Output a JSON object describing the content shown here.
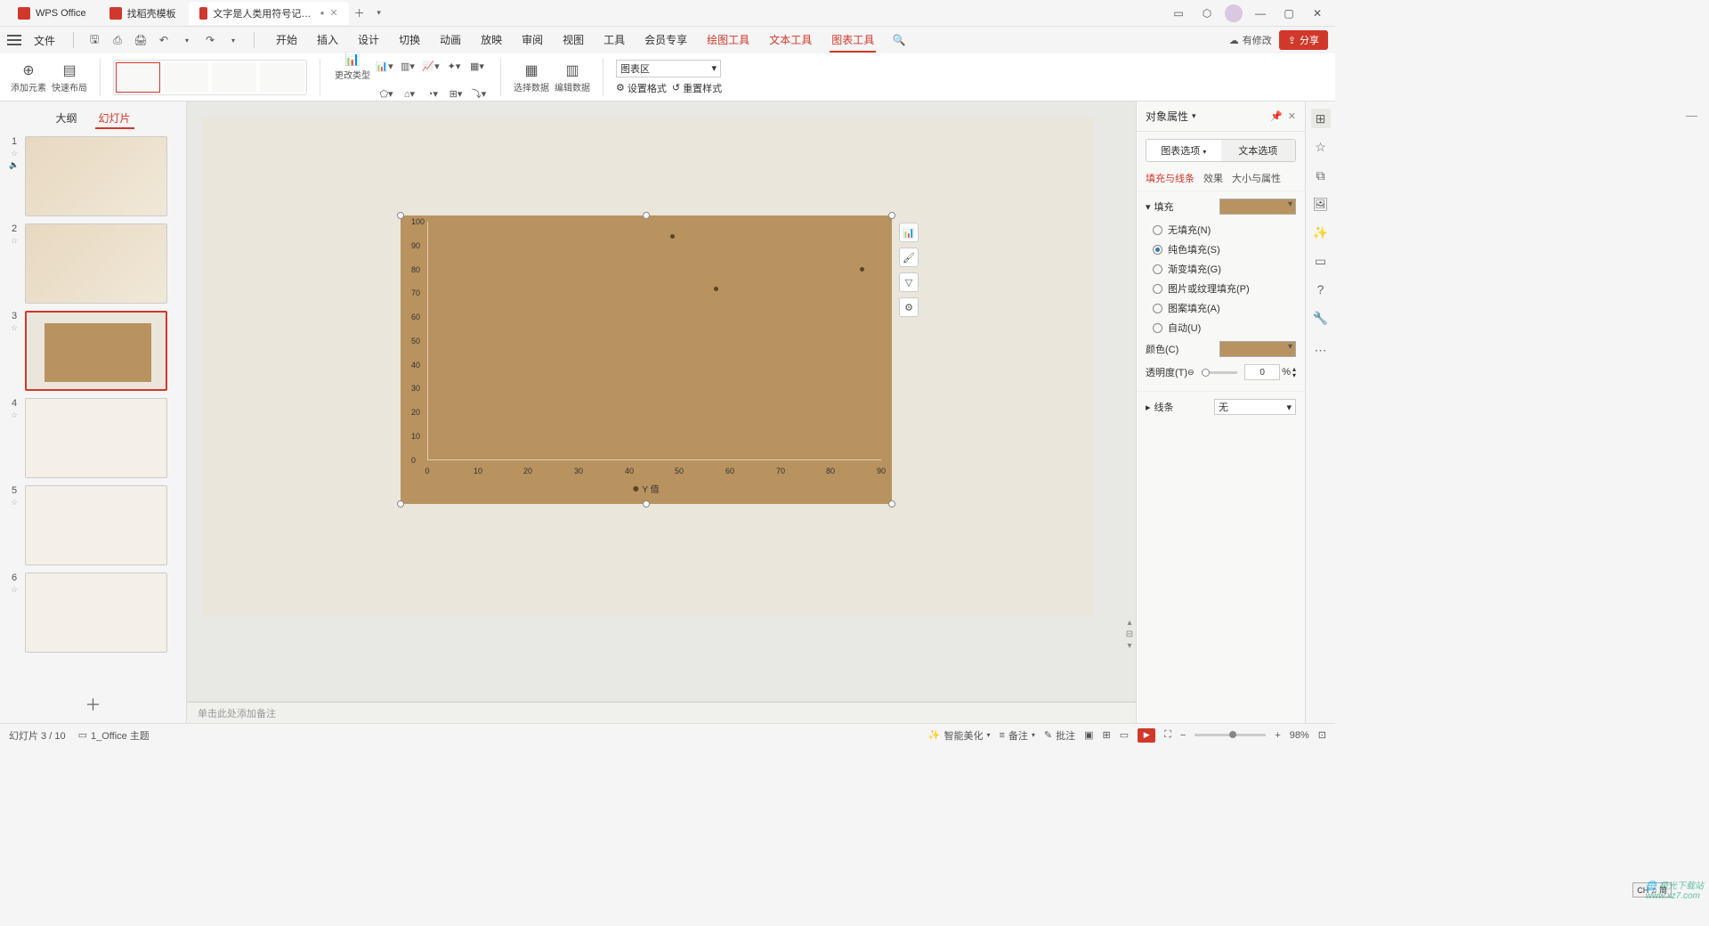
{
  "titlebar": {
    "tabs": [
      {
        "icon": "wps",
        "label": "WPS Office"
      },
      {
        "icon": "tpl",
        "label": "找稻壳模板"
      },
      {
        "icon": "ppt",
        "label": "文字是人类用符号记录表达信息以"
      }
    ],
    "modified_dot": "●"
  },
  "menubar": {
    "file": "文件",
    "ribbon_tabs": [
      "开始",
      "插入",
      "设计",
      "切换",
      "动画",
      "放映",
      "审阅",
      "视图",
      "工具",
      "会员专享",
      "绘图工具",
      "文本工具",
      "图表工具"
    ],
    "cloud_status": "有修改",
    "share": "分享"
  },
  "ribbon": {
    "add_element": "添加元素",
    "quick_layout": "快速布局",
    "change_type": "更改类型",
    "select_data": "选择数据",
    "edit_data": "编辑数据",
    "chart_area_label": "图表区",
    "set_format": "设置格式",
    "reset_style": "重置样式"
  },
  "slide_nav": {
    "tabs": {
      "outline": "大纲",
      "slides": "幻灯片"
    },
    "add": "＋"
  },
  "chart_data": {
    "type": "scatter",
    "selection": "图表区",
    "x_range": [
      0,
      90
    ],
    "y_range": [
      0,
      100
    ],
    "x_ticks": [
      0,
      10,
      20,
      30,
      40,
      50,
      60,
      70,
      80,
      90
    ],
    "y_ticks": [
      0,
      10,
      20,
      30,
      40,
      50,
      60,
      70,
      80,
      90,
      100
    ],
    "series": [
      {
        "name": "Y 值",
        "points": [
          [
            48.5,
            94
          ],
          [
            57,
            72
          ],
          [
            86,
            80
          ]
        ]
      }
    ],
    "background_color": "#b8935f"
  },
  "notes_placeholder": "单击此处添加备注",
  "props": {
    "title": "对象属性",
    "subtabs": {
      "chart_options": "图表选项",
      "text_options": "文本选项"
    },
    "tabs2": {
      "fill_line": "填充与线条",
      "effect": "效果",
      "size_props": "大小与属性"
    },
    "fill_section": "填充",
    "fills": {
      "none": "无填充(N)",
      "solid": "纯色填充(S)",
      "gradient": "渐变填充(G)",
      "picture": "图片或纹理填充(P)",
      "pattern": "图案填充(A)",
      "auto": "自动(U)"
    },
    "color_label": "颜色(C)",
    "opacity_label": "透明度(T)",
    "opacity_value": "0",
    "opacity_unit": "%",
    "line_section": "线条",
    "line_value": "无",
    "fill_color": "#b8935f"
  },
  "statusbar": {
    "slide_pos": "幻灯片 3 / 10",
    "theme": "1_Office 主题",
    "beautify": "智能美化",
    "notes": "备注",
    "comments": "批注",
    "zoom": "98%"
  },
  "ime": "CH ♫ 简",
  "watermark": "🌐 极光下载站\nwww.xz7.com"
}
